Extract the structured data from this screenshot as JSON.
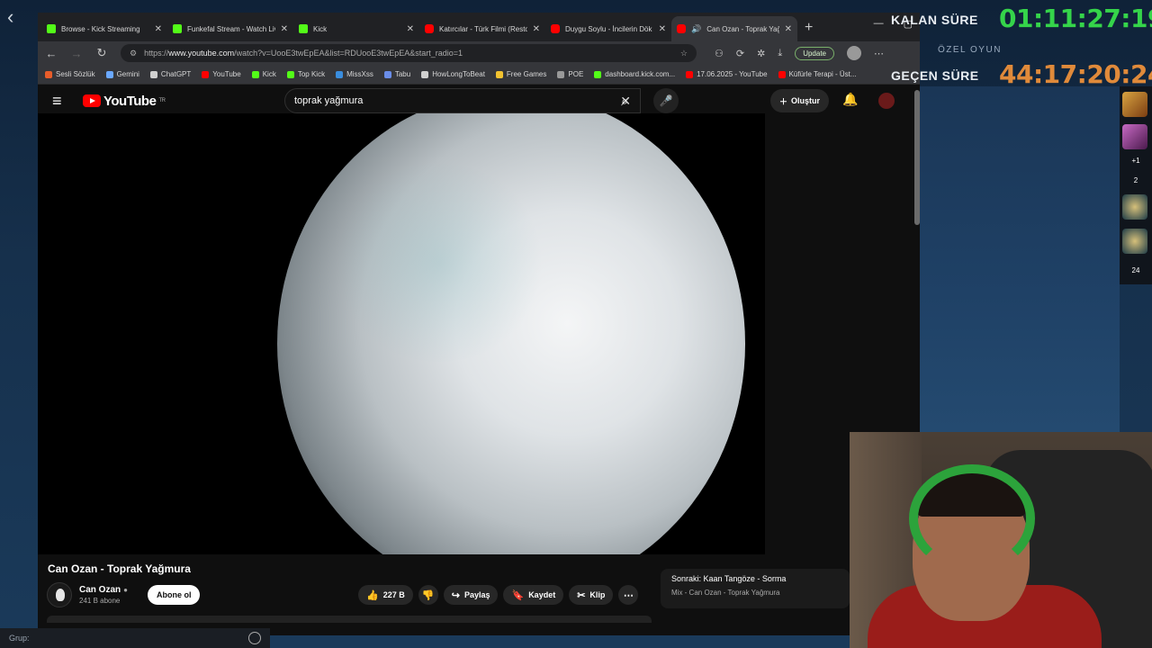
{
  "overlay": {
    "remaining_label": "KALAN SÜRE",
    "remaining_value": "01:11:27:19",
    "subtitle": "ÖZEL OYUN",
    "elapsed_label": "GEÇEN SÜRE",
    "elapsed_value": "44:17:20:24",
    "side_counts": [
      "+1",
      "2",
      "24"
    ],
    "bottom_label": "Grup:"
  },
  "browser": {
    "tabs": [
      {
        "label": "Browse - Kick Streaming",
        "favicon": "kick"
      },
      {
        "label": "Funkefal Stream - Watch Live",
        "favicon": "kick"
      },
      {
        "label": "Kick",
        "favicon": "kick"
      },
      {
        "label": "Katırcılar - Türk Filmi (Restore",
        "favicon": "yt"
      },
      {
        "label": "Duygu Soylu - İncilerin Dök",
        "favicon": "yt"
      },
      {
        "label": "Can Ozan - Toprak Yağ",
        "favicon": "yt"
      }
    ],
    "url_prefix": "https://",
    "url_host": "www.youtube.com",
    "url_path": "/watch?v=UooE3twEpEA&list=RDUooE3twEpEA&start_radio=1",
    "update_label": "Update",
    "bookmarks": [
      {
        "label": "Sesli Sözlük",
        "color": "#e85d2a"
      },
      {
        "label": "Gemini",
        "color": "#6aa8ff"
      },
      {
        "label": "ChatGPT",
        "color": "#cfcfcf"
      },
      {
        "label": "YouTube",
        "color": "#ff0000"
      },
      {
        "label": "Kick",
        "color": "#53fc18"
      },
      {
        "label": "Top Kick",
        "color": "#53fc18"
      },
      {
        "label": "MissXss",
        "color": "#3a8dde"
      },
      {
        "label": "Tabu",
        "color": "#6a8de8"
      },
      {
        "label": "HowLongToBeat",
        "color": "#cfcfcf"
      },
      {
        "label": "Free Games",
        "color": "#f2c230"
      },
      {
        "label": "POE",
        "color": "#999999"
      },
      {
        "label": "dashboard.kick.com...",
        "color": "#53fc18"
      },
      {
        "label": "17.06.2025 - YouTube",
        "color": "#ff0000"
      },
      {
        "label": "Küfürle Terapi - Üst...",
        "color": "#ff0000"
      }
    ]
  },
  "youtube": {
    "logo_text": "YouTube",
    "logo_region": "TR",
    "search_value": "toprak yağmura",
    "create_label": "Oluştur",
    "video_title": "Can Ozan - Toprak Yağmura",
    "channel_name": "Can Ozan",
    "channel_subs": "241 B abone",
    "subscribe_label": "Abone ol",
    "like_count": "227 B",
    "share_label": "Paylaş",
    "save_label": "Kaydet",
    "clip_label": "Klip",
    "next_label": "Sonraki: Kaan Tangöze - Sorma",
    "next_sub": "Mix - Can Ozan - Toprak Yağmura"
  }
}
